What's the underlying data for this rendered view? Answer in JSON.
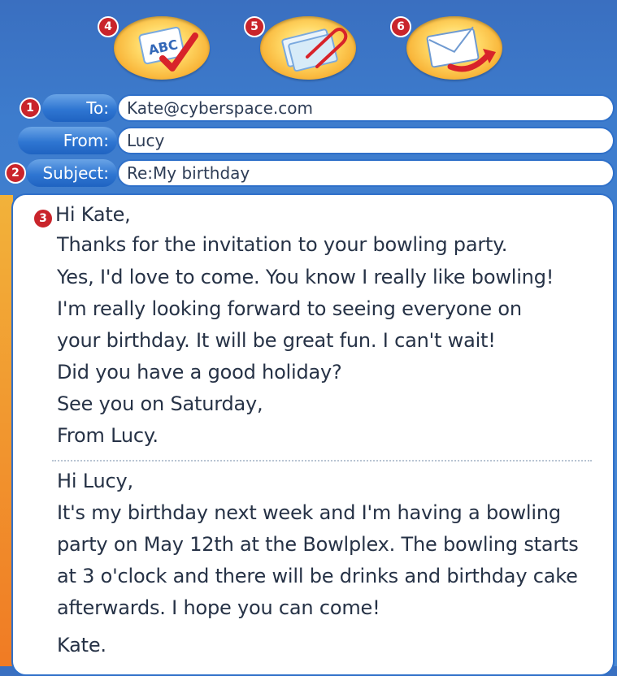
{
  "toolbar": {
    "buttons": [
      {
        "number": "4",
        "icon": "spell-check-icon",
        "icon_text": "ABC"
      },
      {
        "number": "5",
        "icon": "attachment-icon"
      },
      {
        "number": "6",
        "icon": "send-mail-icon"
      }
    ]
  },
  "fields": {
    "to": {
      "number": "1",
      "label": "To:",
      "value": "Kate@cyberspace.com"
    },
    "from": {
      "label": "From:",
      "value": "Lucy"
    },
    "subject": {
      "number": "2",
      "label": "Subject:",
      "value": "Re:My birthday"
    }
  },
  "message": {
    "number": "3",
    "reply_lines": [
      "Hi Kate,",
      "Thanks for the invitation to your bowling party.",
      "Yes, I'd love to come. You know I really like bowling!",
      "I'm really looking forward to seeing everyone on",
      "your birthday. It will be great fun. I can't wait!",
      "Did you have a good holiday?",
      "See you on Saturday,",
      "From Lucy."
    ],
    "original_lines": [
      "Hi Lucy,",
      "It's my birthday next week and I'm having a bowling",
      "party on May 12th at the Bowlplex. The bowling starts",
      "at 3 o'clock and there will be drinks and birthday cake",
      "afterwards. I hope you can come!",
      "Kate."
    ]
  },
  "colors": {
    "accent": "#2f70c9",
    "badge": "#c9242b",
    "button": "#f6a728"
  }
}
